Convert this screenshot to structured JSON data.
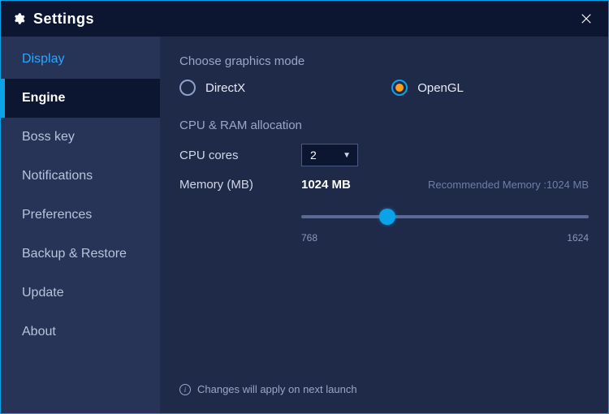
{
  "titlebar": {
    "title": "Settings"
  },
  "sidebar": {
    "items": [
      {
        "label": "Display"
      },
      {
        "label": "Engine"
      },
      {
        "label": "Boss key"
      },
      {
        "label": "Notifications"
      },
      {
        "label": "Preferences"
      },
      {
        "label": "Backup & Restore"
      },
      {
        "label": "Update"
      },
      {
        "label": "About"
      }
    ],
    "active_index": 1
  },
  "graphics": {
    "section_title": "Choose graphics mode",
    "options": [
      {
        "label": "DirectX"
      },
      {
        "label": "OpenGL"
      }
    ],
    "selected_index": 1
  },
  "allocation": {
    "section_title": "CPU & RAM allocation",
    "cpu_label": "CPU cores",
    "cpu_value": "2",
    "memory_label": "Memory (MB)",
    "memory_value": "1024 MB",
    "recommended_text": "Recommended Memory :1024 MB",
    "slider": {
      "min": 768,
      "max": 1624,
      "value": 1024,
      "min_label": "768",
      "max_label": "1624"
    }
  },
  "footer": {
    "note": "Changes will apply on next launch"
  }
}
